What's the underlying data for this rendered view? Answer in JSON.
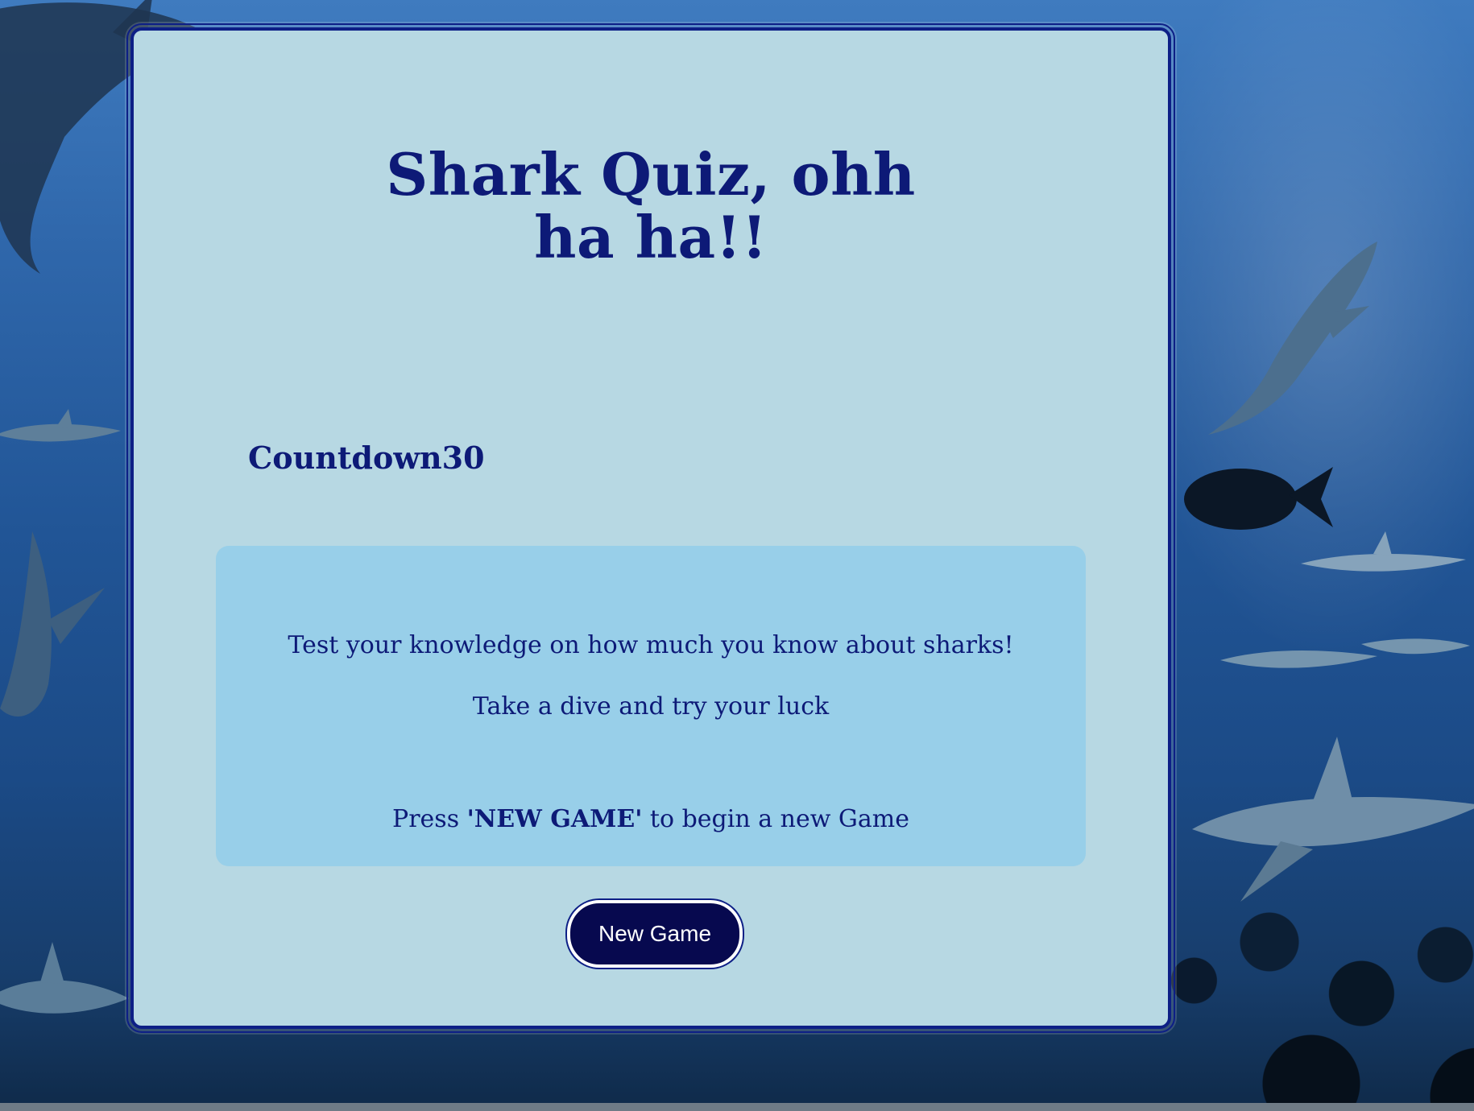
{
  "page": {
    "title": "Shark Quiz, ohh ha ha!!",
    "countdown_label": "Countdown30"
  },
  "intro": {
    "line1": "Test your knowledge on how much you know about sharks!",
    "line2": "Take a dive and try your luck",
    "line3_prefix": "Press ",
    "line3_bold": "'NEW GAME'",
    "line3_suffix": " to begin a new Game"
  },
  "actions": {
    "new_game_label": "New Game"
  },
  "colors": {
    "panel_bg": "#b7d8e3",
    "panel_border": "#0d1f86",
    "info_bg": "#98cfe9",
    "text": "#0d1a77",
    "button_bg": "#07094f",
    "button_text": "#ffffff"
  }
}
